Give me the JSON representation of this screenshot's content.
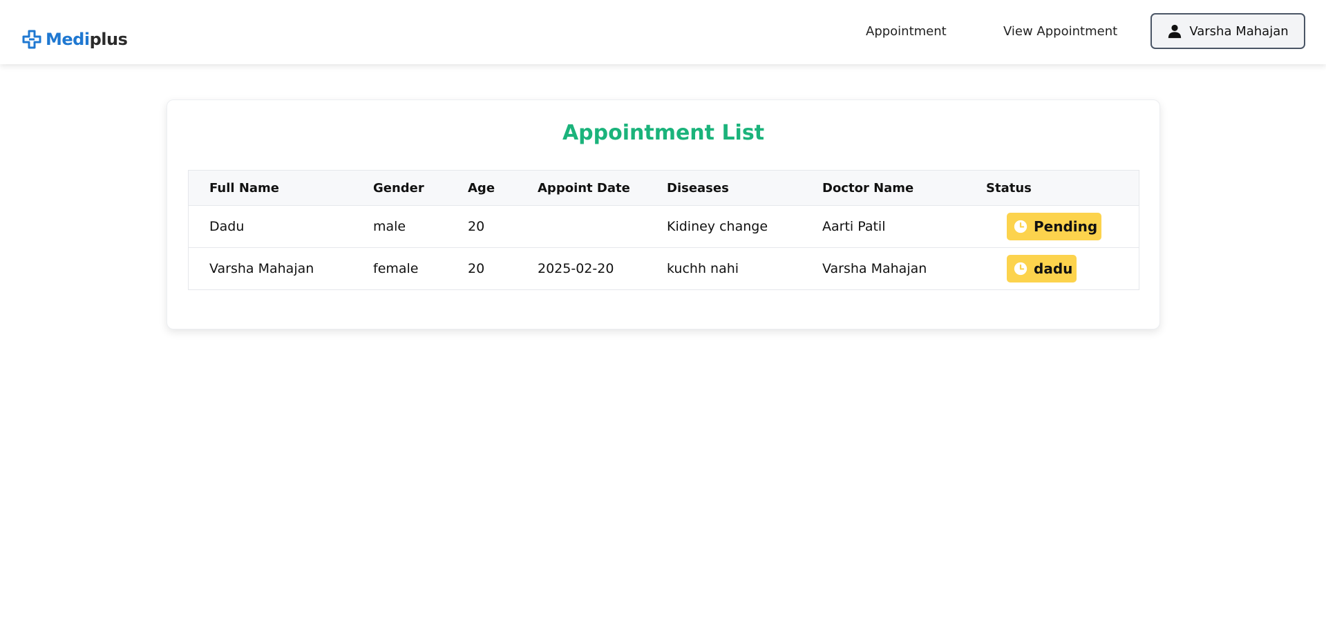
{
  "brand": {
    "name_part1": "Medi",
    "name_part2": "plus",
    "colors": {
      "accent": "#1f78d1",
      "dark": "#2b2b2b"
    },
    "icon": "medical-cross-icon"
  },
  "nav": {
    "links": [
      {
        "label": "Appointment"
      },
      {
        "label": "View Appointment"
      }
    ],
    "user": {
      "name": "Varsha Mahajan",
      "icon": "user-icon"
    }
  },
  "main": {
    "title": "Appointment List",
    "title_color": "#1bb37b",
    "table": {
      "columns": [
        "Full Name",
        "Gender",
        "Age",
        "Appoint Date",
        "Diseases",
        "Doctor Name",
        "Status"
      ],
      "rows": [
        {
          "full_name": "Dadu",
          "gender": "male",
          "age": "20",
          "appoint_date": "",
          "diseases": "Kidiney change",
          "doctor_name": "Aarti Patil",
          "status": "Pending",
          "status_icon": "clock-icon"
        },
        {
          "full_name": "Varsha Mahajan",
          "gender": "female",
          "age": "20",
          "appoint_date": "2025-02-20",
          "diseases": "kuchh nahi",
          "doctor_name": "Varsha Mahajan",
          "status": "dadu",
          "status_icon": "clock-icon"
        }
      ],
      "status_badge_color": "#fcd34d"
    }
  }
}
